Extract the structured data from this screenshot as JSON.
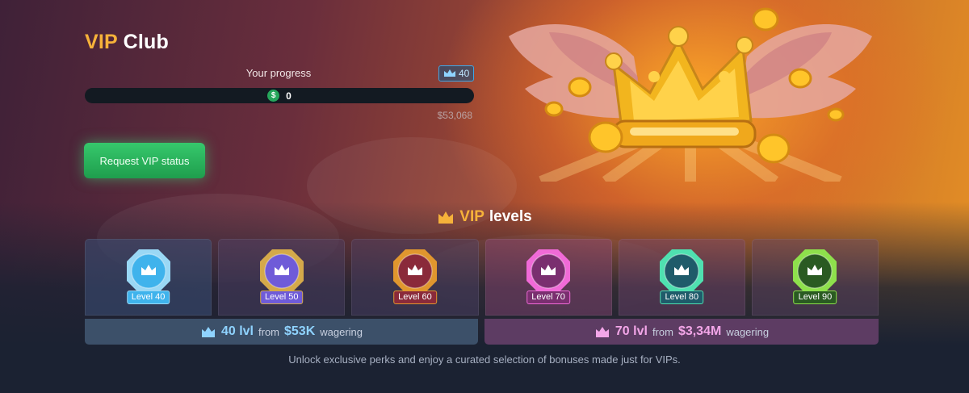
{
  "hero": {
    "title_vip": "VIP",
    "title_club": "Club",
    "progress_label": "Your progress",
    "level_badge": "40",
    "progress_value": "0",
    "progress_fraction": 0,
    "progress_target": "$53,068",
    "request_button": "Request VIP status"
  },
  "levels": {
    "title_vip": "VIP",
    "title_rest": "levels",
    "cards": [
      {
        "label": "Level 40",
        "color": "#3fb3ec",
        "frame": "#9ad8f5"
      },
      {
        "label": "Level 50",
        "color": "#6f5bd8",
        "frame": "#d4a94a"
      },
      {
        "label": "Level 60",
        "color": "#8a2a3a",
        "frame": "#e0962e"
      },
      {
        "label": "Level 70",
        "color": "#7a2f6f",
        "frame": "#f06ad7"
      },
      {
        "label": "Level 80",
        "color": "#1f5b6a",
        "frame": "#4fe0b0"
      },
      {
        "label": "Level 90",
        "color": "#2a5a22",
        "frame": "#8ee04c"
      }
    ],
    "tiers": [
      {
        "level": "40 lvl",
        "from": "from",
        "amount": "$53K",
        "suffix": "wagering"
      },
      {
        "level": "70 lvl",
        "from": "from",
        "amount": "$3,34M",
        "suffix": "wagering"
      }
    ]
  },
  "footer": {
    "text": "Unlock exclusive perks and enjoy a curated selection of bonuses made just for VIPs."
  },
  "icons": {
    "crown": "crown-icon",
    "dollar": "dollar-coin-icon"
  },
  "colors": {
    "accent_gold": "#f6b23a",
    "green_button": "#2ab565",
    "tier1": "#8fd3ff",
    "tier2": "#f3a6e8"
  }
}
